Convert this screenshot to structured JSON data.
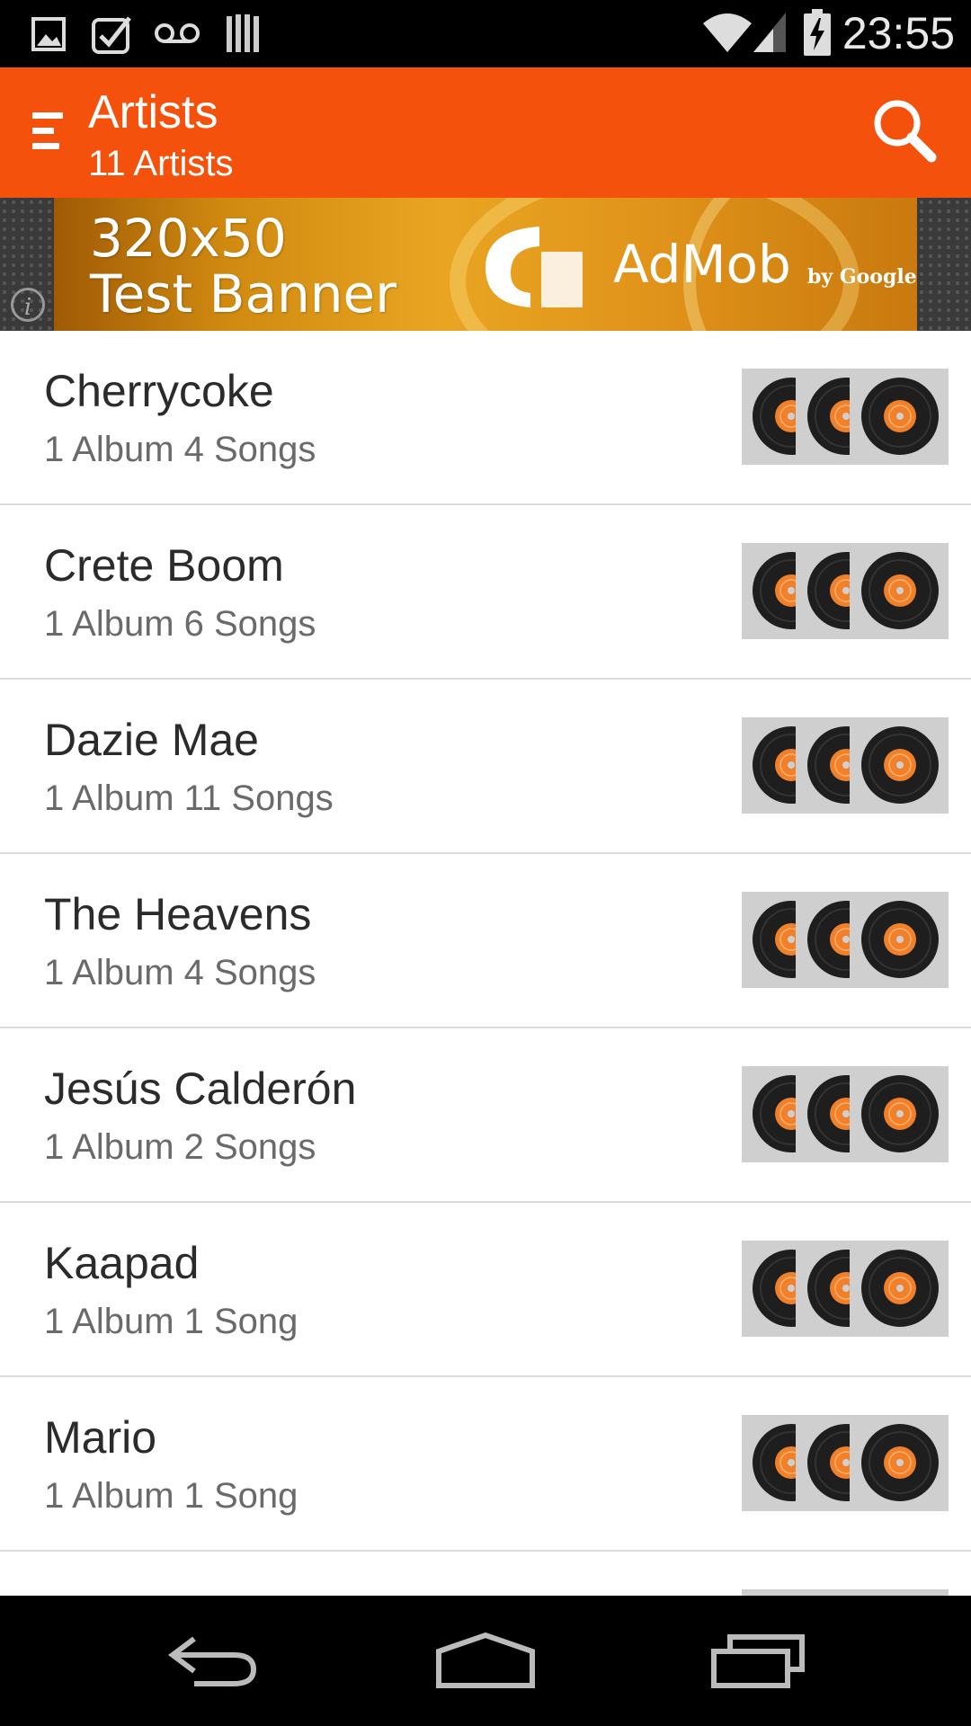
{
  "status_bar": {
    "time": "23:55",
    "left_icons": [
      "image-icon",
      "task-check-icon",
      "voicemail-icon",
      "barcode-icon"
    ],
    "right_icons": [
      "wifi-icon",
      "signal-icon",
      "battery-charging-icon"
    ]
  },
  "app_bar": {
    "title": "Artists",
    "subtitle": "11 Artists",
    "background": "#f4510d",
    "menu_icon": "hamburger-menu-icon",
    "search_icon": "search-icon"
  },
  "ad_banner": {
    "line1": "320x50",
    "line2": "Test Banner",
    "brand": "AdMob",
    "brand_sub": "by Google",
    "info": "i"
  },
  "artists": [
    {
      "name": "Cherrycoke",
      "meta": "1 Album 4 Songs"
    },
    {
      "name": "Crete Boom",
      "meta": "1 Album 6 Songs"
    },
    {
      "name": "Dazie Mae",
      "meta": "1 Album 11 Songs"
    },
    {
      "name": "The Heavens",
      "meta": "1 Album 4 Songs"
    },
    {
      "name": "Jesús Calderón",
      "meta": "1 Album 2 Songs"
    },
    {
      "name": "Kaapad",
      "meta": "1 Album 1 Song"
    },
    {
      "name": "Mario",
      "meta": "1 Album 1 Song"
    },
    {
      "name": "",
      "meta": ""
    }
  ],
  "nav_bar": {
    "buttons": [
      "back-icon",
      "home-icon",
      "recent-apps-icon"
    ]
  }
}
